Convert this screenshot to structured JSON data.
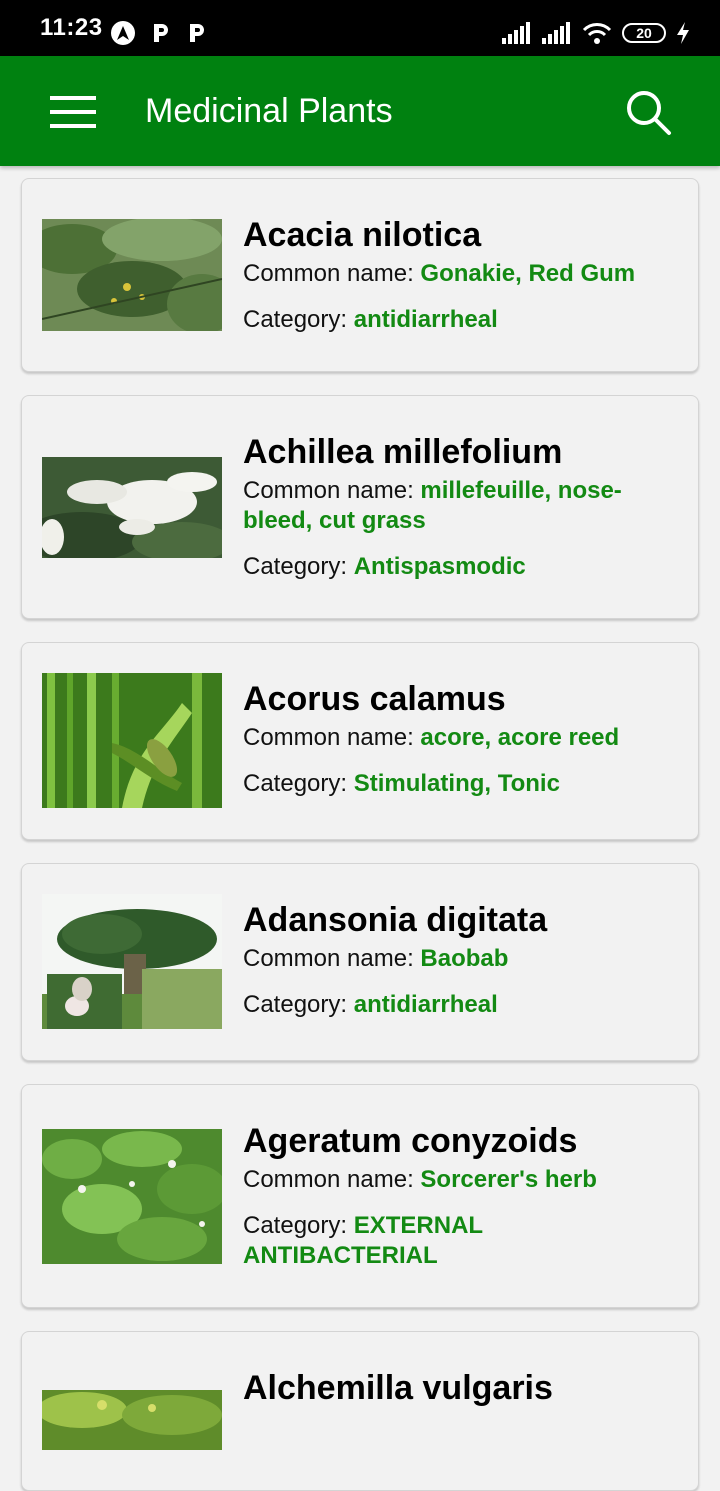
{
  "status_bar": {
    "time": "11:23",
    "notifications": [
      "navigation-app-icon",
      "parking-app-icon",
      "parking-app-icon"
    ],
    "battery": "20"
  },
  "app_bar": {
    "title": "Medicinal Plants",
    "background_color": "#008110"
  },
  "labels": {
    "common_name": "Common name: ",
    "category": "Category: "
  },
  "accent_color": "#138a13",
  "plants": [
    {
      "name": "Acacia nilotica",
      "common_name": "Gonakie, Red Gum",
      "category": "antidiarrheal"
    },
    {
      "name": "Achillea millefolium",
      "common_name": "millefeuille, nose-bleed, cut grass",
      "category": "Antispasmodic"
    },
    {
      "name": "Acorus calamus",
      "common_name": "acore, acore reed",
      "category": "Stimulating, Tonic"
    },
    {
      "name": "Adansonia digitata",
      "common_name": "Baobab",
      "category": "antidiarrheal"
    },
    {
      "name": "Ageratum conyzoids",
      "common_name": "Sorcerer's herb",
      "category": "EXTERNAL ANTIBACTERIAL"
    },
    {
      "name": "Alchemilla vulgaris",
      "common_name": "",
      "category": ""
    }
  ]
}
